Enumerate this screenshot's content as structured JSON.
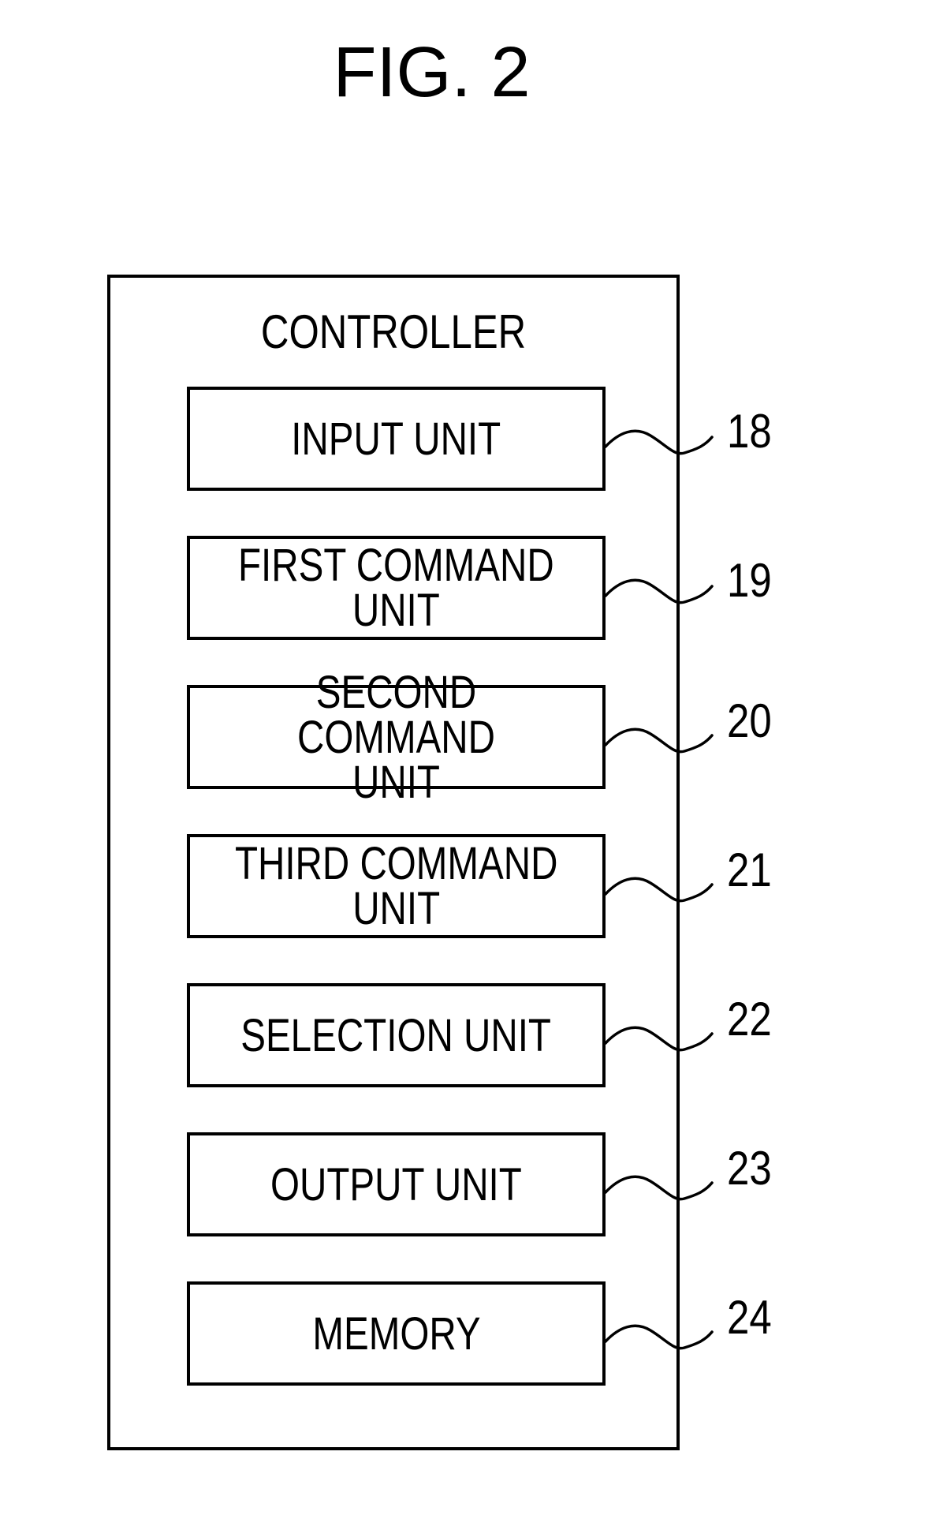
{
  "figure": {
    "title": "FIG. 2"
  },
  "controller": {
    "label": "CONTROLLER",
    "units": [
      {
        "label": "INPUT UNIT",
        "ref": "18"
      },
      {
        "label": "FIRST COMMAND\nUNIT",
        "ref": "19"
      },
      {
        "label": "SECOND COMMAND\nUNIT",
        "ref": "20"
      },
      {
        "label": "THIRD COMMAND\nUNIT",
        "ref": "21"
      },
      {
        "label": "SELECTION UNIT",
        "ref": "22"
      },
      {
        "label": "OUTPUT UNIT",
        "ref": "23"
      },
      {
        "label": "MEMORY",
        "ref": "24"
      }
    ]
  }
}
